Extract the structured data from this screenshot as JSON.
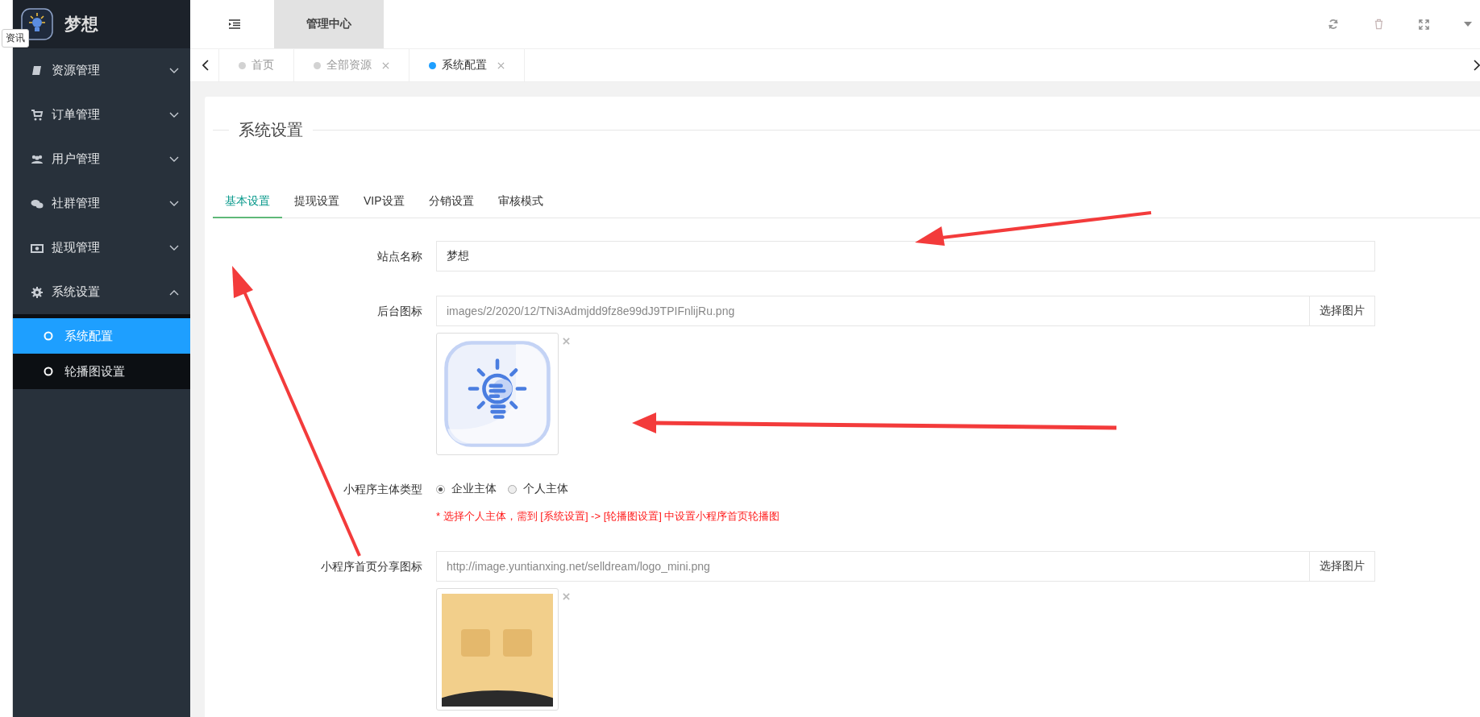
{
  "left_edge": {
    "tooltip": "资讯"
  },
  "brand": {
    "name": "梦想"
  },
  "sidebar": {
    "items": [
      {
        "label": "资源管理",
        "expanded": false
      },
      {
        "label": "订单管理",
        "expanded": false
      },
      {
        "label": "用户管理",
        "expanded": false
      },
      {
        "label": "社群管理",
        "expanded": false
      },
      {
        "label": "提现管理",
        "expanded": false
      },
      {
        "label": "系统设置",
        "expanded": true,
        "children": [
          {
            "label": "系统配置",
            "selected": true
          },
          {
            "label": "轮播图设置",
            "selected": false
          }
        ]
      }
    ]
  },
  "topbar": {
    "tabs": [
      {
        "label": "管理中心",
        "selected": true
      }
    ]
  },
  "page_tabs": [
    {
      "label": "首页",
      "selected": false,
      "closable": false
    },
    {
      "label": "全部资源",
      "selected": false,
      "closable": true
    },
    {
      "label": "系统配置",
      "selected": true,
      "closable": true
    }
  ],
  "card": {
    "title": "系统设置",
    "tabs": [
      {
        "label": "基本设置",
        "selected": true
      },
      {
        "label": "提现设置",
        "selected": false
      },
      {
        "label": "VIP设置",
        "selected": false
      },
      {
        "label": "分销设置",
        "selected": false
      },
      {
        "label": "审核模式",
        "selected": false
      }
    ],
    "fields": [
      {
        "kind": "text",
        "label": "站点名称",
        "value": "梦想"
      },
      {
        "label": "后台图标",
        "value": "images/2/2020/12/TNi3Admjdd9fz8e99dJ9TPIFnlijRu.png",
        "button": "选择图片",
        "preview": {
          "kind": "icon"
        }
      },
      {
        "kind": "radio",
        "label": "小程序主体类型",
        "options": [
          {
            "label": "企业主体",
            "selected": true
          },
          {
            "label": "个人主体",
            "selected": false
          }
        ],
        "note": "* 选择个人主体，需到 [系统设置] -> [轮播图设置] 中设置小程序首页轮播图"
      },
      {
        "label": "小程序首页分享图标",
        "value": "http://image.yuntianxing.net/selldream/logo_mini.png",
        "button": "选择图片"
      }
    ]
  }
}
